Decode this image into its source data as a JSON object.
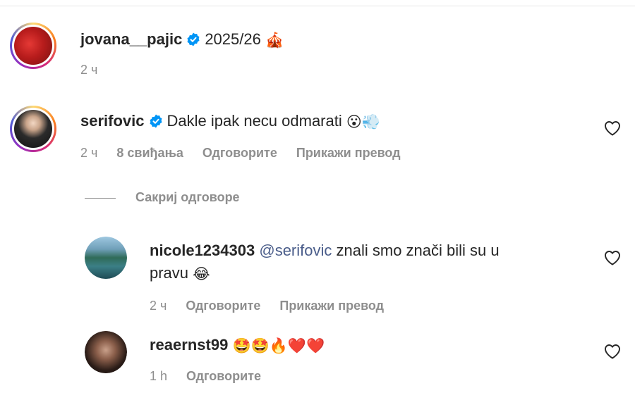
{
  "comments": [
    {
      "username": "jovana__pajic",
      "text": "2025/26",
      "emoji": "🎪",
      "time": "2 ч"
    },
    {
      "username": "serifovic",
      "text": "Dakle ipak necu odmarati",
      "emoji": "😮💨",
      "time": "2 ч",
      "likes": "8 свиђања",
      "reply_label": "Одговорите",
      "translate_label": "Прикажи превод"
    }
  ],
  "hide_replies_label": "Сакриј одговоре",
  "replies": [
    {
      "username": "nicole1234303",
      "mention": "@serifovic",
      "text_line1": "znali smo znači bili su u",
      "text_line2": "pravu",
      "emoji": "😂",
      "time": "2 ч",
      "reply_label": "Одговорите",
      "translate_label": "Прикажи превод"
    },
    {
      "username": "reaernst99",
      "emoji": "🤩🤩🔥❤️❤️",
      "time": "1 h",
      "reply_label": "Одговорите"
    }
  ],
  "icons": {
    "verified": "verified-badge-icon",
    "heart": "heart-outline-icon"
  },
  "colors": {
    "verified_blue": "#0095f6",
    "mention": "#4a5d8a",
    "meta_gray": "#8e8e8e"
  }
}
